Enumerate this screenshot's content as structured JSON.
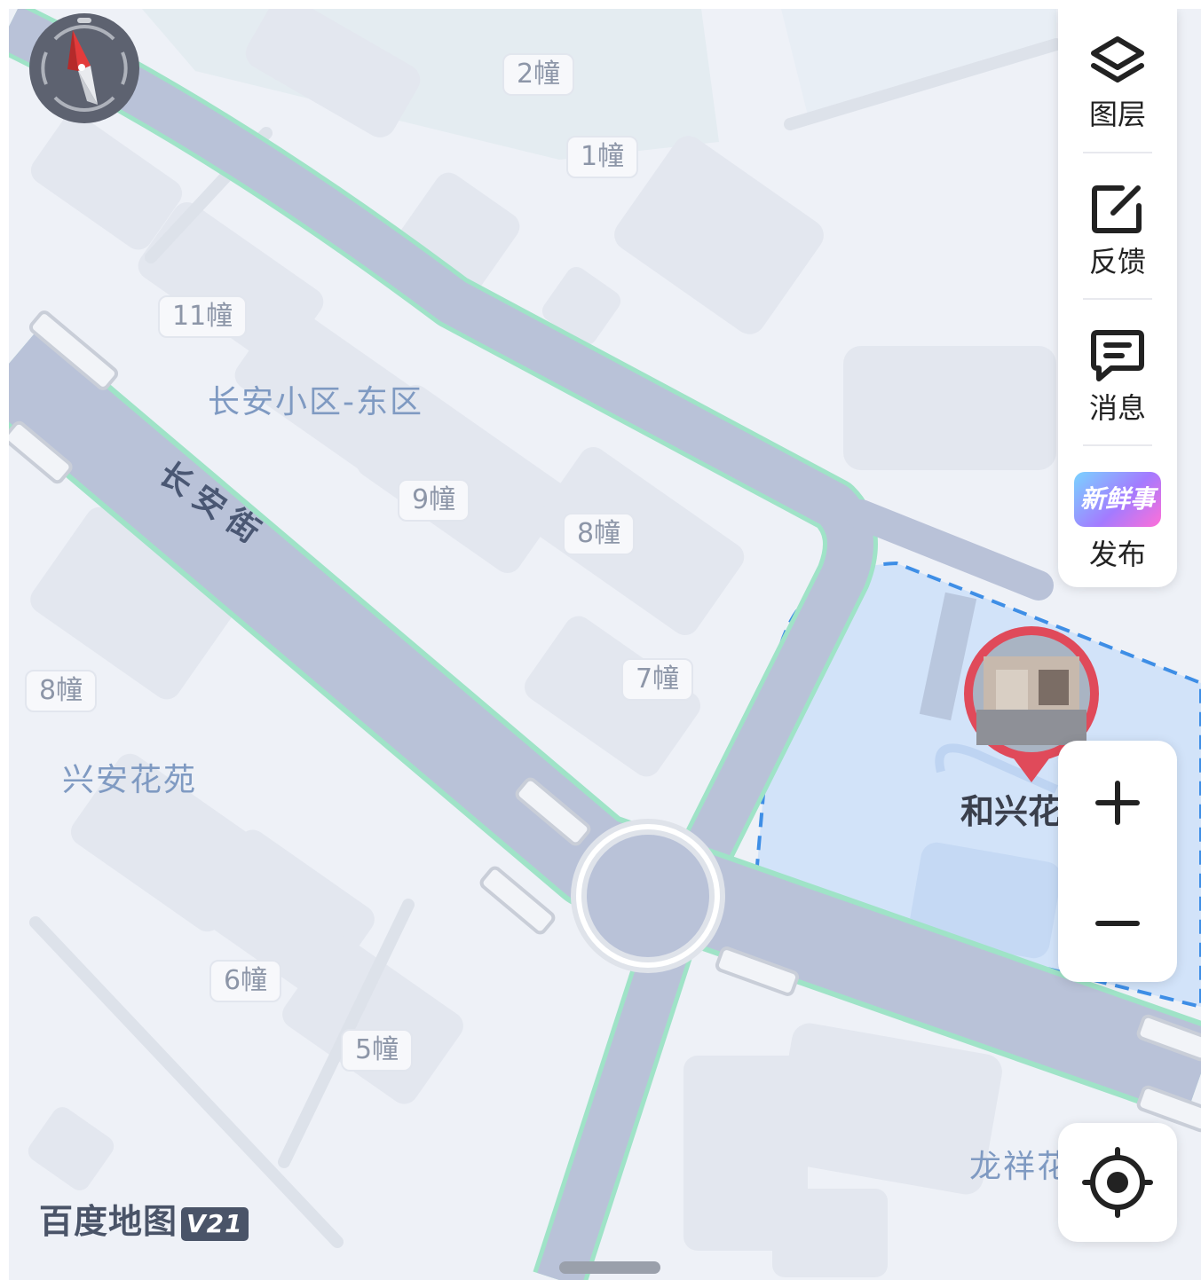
{
  "building_labels": [
    {
      "id": "b1",
      "text": "2幢"
    },
    {
      "id": "b2",
      "text": "1幢"
    },
    {
      "id": "b3",
      "text": "11幢"
    },
    {
      "id": "b4",
      "text": "9幢"
    },
    {
      "id": "b5",
      "text": "8幢"
    },
    {
      "id": "b6",
      "text": "7幢"
    },
    {
      "id": "b7",
      "text": "8幢"
    },
    {
      "id": "b8",
      "text": "6幢"
    },
    {
      "id": "b9",
      "text": "5幢"
    }
  ],
  "areas": {
    "changan_east": "长安小区-东区",
    "xingan": "兴安花苑",
    "longxiang": "龙祥花园小区"
  },
  "street": "长安街",
  "poi": {
    "name": "和兴花园"
  },
  "toolbar": {
    "layers": "图层",
    "feedback": "反馈",
    "messages": "消息",
    "badge": "新鲜事",
    "publish": "发布"
  },
  "logo": {
    "text": "百度地图",
    "version": "V21"
  },
  "colors": {
    "road": "#b9c2d8",
    "road_green": "#9fe3c7",
    "background": "#eef1f7",
    "building": "#e3e7ef",
    "poi_area": "#d2e3f9",
    "poi_border": "#3e8ee6",
    "pin": "#e04a5a"
  }
}
